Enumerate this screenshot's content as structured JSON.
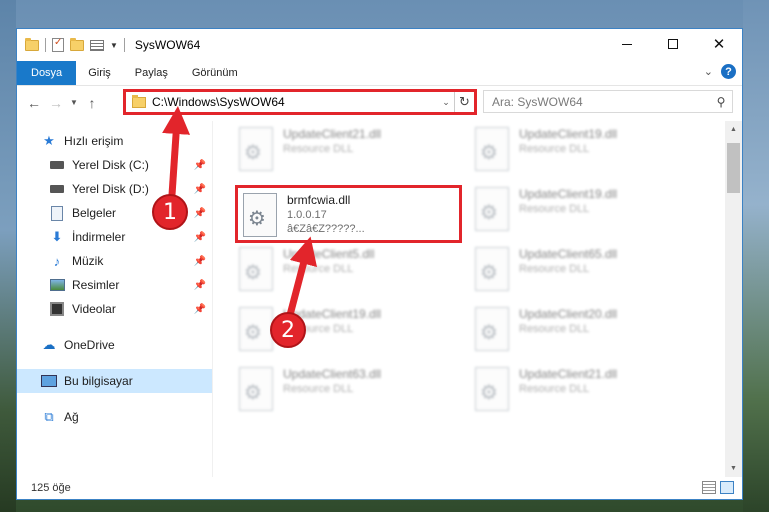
{
  "window": {
    "title": "SysWOW64"
  },
  "ribbon": {
    "tabs": [
      "Dosya",
      "Giriş",
      "Paylaş",
      "Görünüm"
    ]
  },
  "address": {
    "path": "C:\\Windows\\SysWOW64",
    "search_placeholder": "Ara: SysWOW64"
  },
  "nav": {
    "quick_access": "Hızlı erişim",
    "items": [
      "Yerel Disk (C:)",
      "Yerel Disk (D:)",
      "Belgeler",
      "İndirmeler",
      "Müzik",
      "Resimler",
      "Videolar"
    ],
    "onedrive": "OneDrive",
    "this_pc": "Bu bilgisayar",
    "network": "Ağ"
  },
  "files": [
    {
      "name": "UpdateClient21.dll",
      "sub": "Resource DLL"
    },
    {
      "name": "UpdateClient19.dll",
      "sub": "Resource DLL"
    },
    {
      "name": "brmfcwia.dll",
      "version": "1.0.0.17",
      "desc": "â€Zâ€Z?????..."
    },
    {
      "name": "UpdateClient19.dll",
      "sub": "Resource DLL"
    },
    {
      "name": "UpdateClient5.dll",
      "sub": "Resource DLL"
    },
    {
      "name": "UpdateClient65.dll",
      "sub": "Resource DLL"
    },
    {
      "name": "UpdateClient19.dll",
      "sub": "Resource DLL"
    },
    {
      "name": "UpdateClient20.dll",
      "sub": "Resource DLL"
    },
    {
      "name": "UpdateClient63.dll",
      "sub": "Resource DLL"
    },
    {
      "name": "UpdateClient21.dll",
      "sub": "Resource DLL"
    }
  ],
  "status": {
    "count": "125 öğe"
  },
  "callouts": [
    "1",
    "2"
  ],
  "colors": {
    "accent": "#1979ca",
    "highlight": "#e2252b",
    "selected": "#cce8ff"
  }
}
